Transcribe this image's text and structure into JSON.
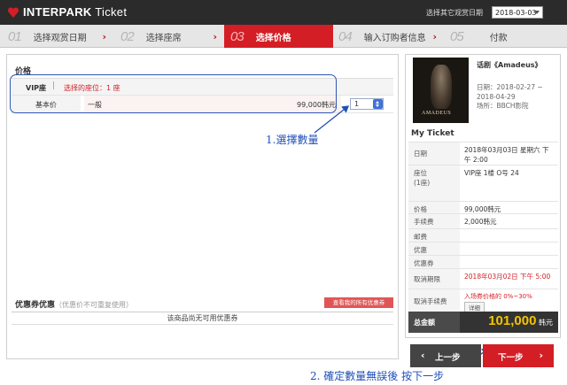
{
  "header": {
    "brand": "INTERPARK",
    "product": "Ticket",
    "date_label": "选择其它观赏日期",
    "date_value": "2018-03-03"
  },
  "steps": [
    {
      "num": "01",
      "label": "选择观赏日期"
    },
    {
      "num": "02",
      "label": "选择座席"
    },
    {
      "num": "03",
      "label": "选择价格"
    },
    {
      "num": "04",
      "label": "输入订购者信息"
    },
    {
      "num": "05",
      "label": "付款"
    }
  ],
  "price": {
    "title": "价格",
    "zone": "VIP座",
    "seat_label": "选择的座位：1 座",
    "row_label": "基本价",
    "row_type": "一般",
    "row_price": "99,000韩元",
    "quantity": "1"
  },
  "annotations": {
    "step1": "1.選擇數量",
    "step2": "2. 確定數量無誤後 按下一步"
  },
  "coupon": {
    "title": "优惠券优惠",
    "note": "（优惠价不可重复使用）",
    "button": "查看我的所有优惠券",
    "empty": "该商品尚无可用优惠券"
  },
  "show": {
    "poster_text": "AMADEUS",
    "title": "话剧《Amadeus》",
    "dates": "日期：2018-02-27 ~ 2018-04-29",
    "venue": "场所：BBCH影院"
  },
  "ticket": {
    "title": "My Ticket",
    "rows": [
      {
        "k": "日期",
        "v": "2018年03月03日 星期六 下午 2:00"
      },
      {
        "k": "座位\n(1座)",
        "v": "VIP座 1楼 O号 24"
      },
      {
        "k": "价格",
        "v": "99,000韩元"
      },
      {
        "k": "手续费",
        "v": "2,000韩元"
      },
      {
        "k": "邮费",
        "v": ""
      },
      {
        "k": "优惠",
        "v": ""
      },
      {
        "k": "优惠券",
        "v": ""
      },
      {
        "k": "取消期限",
        "v": "2018年03月02日 下午 5:00"
      },
      {
        "k": "取消手续费",
        "v": "入场券价格的 0%~30%"
      }
    ],
    "detail_btn": "详细",
    "total_label": "总金额",
    "total_value": "101,000",
    "total_unit": "韩元"
  },
  "nav": {
    "prev": "上一步",
    "next": "下一步"
  },
  "colors": {
    "accent": "#d41e25",
    "annotation": "#2050b8",
    "total_value": "#f5c400"
  }
}
